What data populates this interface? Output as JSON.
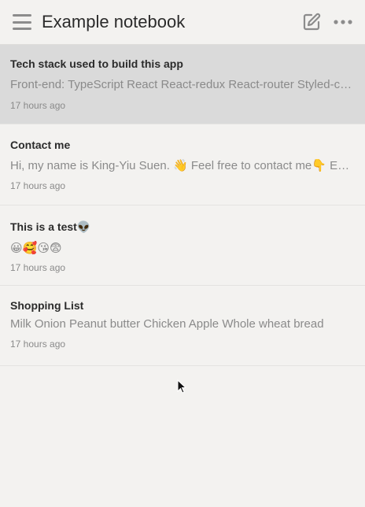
{
  "header": {
    "title": "Example notebook",
    "menu_icon": "hamburger-menu-icon",
    "compose_icon": "compose-icon",
    "more_icon": "more-dots-icon"
  },
  "notes": [
    {
      "title": "Tech stack used to build this app",
      "preview": "Front-end: TypeScript React React-redux React-router Styled-co…",
      "time": "17 hours ago",
      "selected": true
    },
    {
      "title": "Contact me",
      "preview": "Hi, my name is King-Yiu Suen. 👋 Feel free to contact me👇 Email…",
      "time": "17 hours ago",
      "selected": false
    },
    {
      "title": "This is a test👽",
      "preview": "😀🥰😘😨",
      "time": "17 hours ago",
      "selected": false
    },
    {
      "title": "Shopping List",
      "preview": "Milk Onion Peanut butter Chicken Apple Whole wheat bread",
      "time": "17 hours ago",
      "selected": false
    }
  ],
  "colors": {
    "background": "#f3f2f0",
    "selected_row": "#dadada",
    "icon_gray": "#8c8c8c"
  }
}
